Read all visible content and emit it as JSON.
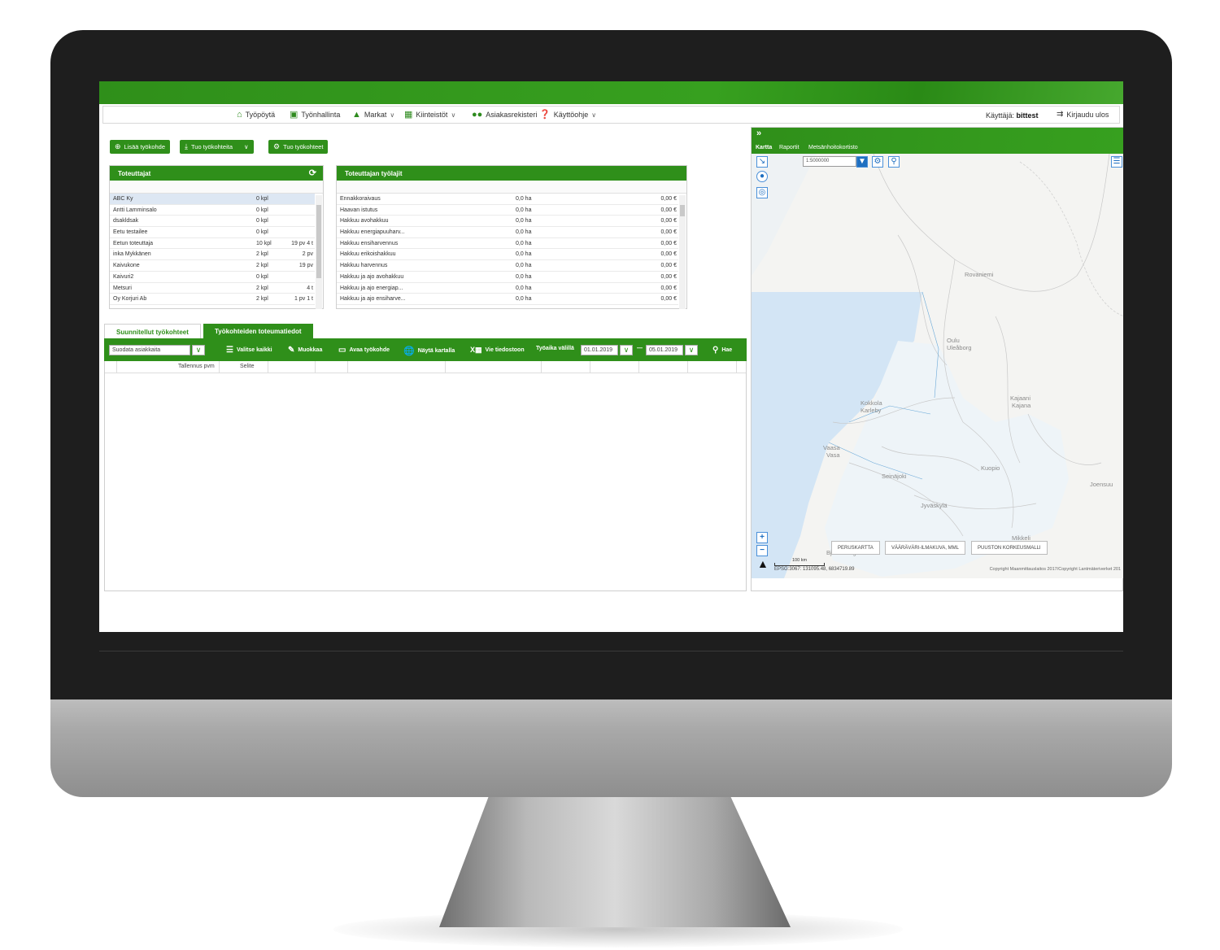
{
  "nav": {
    "items": [
      {
        "label": "Työpöytä",
        "icon": "home-icon",
        "chevron": false
      },
      {
        "label": "Työnhallinta",
        "icon": "briefcase-icon",
        "chevron": false
      },
      {
        "label": "Markat",
        "icon": "tree-icon",
        "chevron": true
      },
      {
        "label": "Kiinteistöt",
        "icon": "map-area-icon",
        "chevron": true
      },
      {
        "label": "Asiakasrekisteri",
        "icon": "users-icon",
        "chevron": false
      },
      {
        "label": "Käyttöohje",
        "icon": "help-icon",
        "chevron": true
      }
    ],
    "user_label": "Käyttäjä:",
    "user_name": "bittest",
    "logout_label": "Kirjaudu ulos"
  },
  "actions": {
    "add_label": "Lisää työkohde",
    "import_file_label": "Tuo työkohteita",
    "import_label": "Tuo työkohteet"
  },
  "executors": {
    "title": "Toteuttajat",
    "rows": [
      {
        "name": "ABC Ky",
        "count": "0 kpl",
        "extra": ""
      },
      {
        "name": "Antti Lamminsalo",
        "count": "0 kpl",
        "extra": ""
      },
      {
        "name": "dsakldsak",
        "count": "0 kpl",
        "extra": ""
      },
      {
        "name": "Eetu testailee",
        "count": "0 kpl",
        "extra": ""
      },
      {
        "name": "Eetun toteuttaja",
        "count": "10 kpl",
        "extra": "19 pv 4 t"
      },
      {
        "name": "inka Mykkänen",
        "count": "2 kpl",
        "extra": "2 pv"
      },
      {
        "name": "Kaivukone",
        "count": "2 kpl",
        "extra": "19 pv"
      },
      {
        "name": "Kaivuri2",
        "count": "0 kpl",
        "extra": ""
      },
      {
        "name": "Metsuri",
        "count": "2 kpl",
        "extra": "4 t"
      },
      {
        "name": "Oy Korjuri Ab",
        "count": "2 kpl",
        "extra": "1 pv 1 t"
      }
    ]
  },
  "worktypes": {
    "title": "Toteuttajan työlajit",
    "rows": [
      {
        "name": "Ennakkoraivaus",
        "area": "0,0 ha",
        "cost": "0,00 €"
      },
      {
        "name": "Haavan istutus",
        "area": "0,0 ha",
        "cost": "0,00 €"
      },
      {
        "name": "Hakkuu avohakkuu",
        "area": "0,0 ha",
        "cost": "0,00 €"
      },
      {
        "name": "Hakkuu energiapuuharv...",
        "area": "0,0 ha",
        "cost": "0,00 €"
      },
      {
        "name": "Hakkuu ensiharvennus",
        "area": "0,0 ha",
        "cost": "0,00 €"
      },
      {
        "name": "Hakkuu erikoishakkuu",
        "area": "0,0 ha",
        "cost": "0,00 €"
      },
      {
        "name": "Hakkuu harvennus",
        "area": "0,0 ha",
        "cost": "0,00 €"
      },
      {
        "name": "Hakkuu ja ajo avohakkuu",
        "area": "0,0 ha",
        "cost": "0,00 €"
      },
      {
        "name": "Hakkuu ja ajo energiap...",
        "area": "0,0 ha",
        "cost": "0,00 €"
      },
      {
        "name": "Hakkuu ja ajo ensiharve...",
        "area": "0,0 ha",
        "cost": "0,00 €"
      }
    ]
  },
  "tabs": {
    "planned": "Suunnitellut työkohteet",
    "realized": "Työkohteiden toteumatiedot"
  },
  "toolbar": {
    "filter_placeholder": "Suodata asiakkaita",
    "select_all": "Valitse kaikki",
    "edit": "Muokkaa",
    "open": "Avaa työkohde",
    "show_map": "Näytä kartalla",
    "export": "Vie tiedostoon",
    "period_label": "Työaika välillä",
    "date_from": "01.01.2019",
    "dash": "—",
    "date_to": "05.01.2019",
    "search": "Hae"
  },
  "grid": {
    "columns": [
      "Tallennus pvm",
      "Selite"
    ]
  },
  "map": {
    "collapse": "»",
    "tabs": [
      "Kartta",
      "Raportit",
      "Metsänhoitokortisto"
    ],
    "scale": "1:5000000",
    "cities": [
      "Rovaniemi",
      "Oulu",
      "Uleåborg",
      "Kokkola",
      "Karleby",
      "Kajaani",
      "Kajana",
      "Vaasa",
      "Vasa",
      "Seinäjoki",
      "Kuopio",
      "Joensuu",
      "Jyväskylä",
      "Mikkeli",
      "Björneborg"
    ],
    "layers": [
      "PERUSKARTTA",
      "VÄÄRÄVÄRI-ILMAKUVA, MML",
      "PUUSTON KORKEUSMALLI"
    ],
    "scalebar": "100 km",
    "coords": "EPSG:3067: 131095.48, 6834719.89",
    "copyright": "Copyright Maanmittauslaitos 2017/Copyright Lantmäteriverket 201"
  },
  "colors": {
    "brand_green": "#2f8f1a",
    "selected_row": "#dde7f3",
    "water": "#cfe3f5"
  }
}
